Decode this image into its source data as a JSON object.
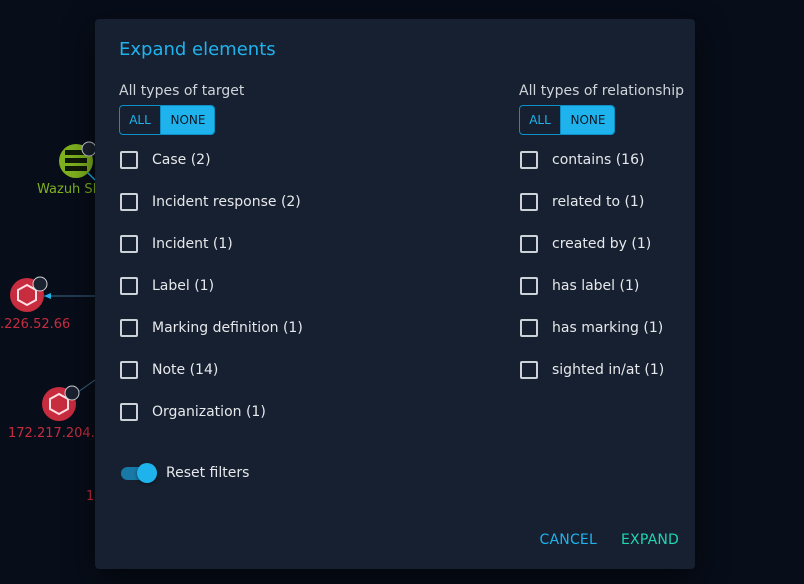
{
  "background": {
    "nodes": [
      {
        "label": "Wazuh SI",
        "icon": "server-icon",
        "color": "#7fb21f"
      },
      {
        "label": ".226.52.66",
        "icon": "hexagon-icon",
        "color": "#c72c3f"
      },
      {
        "label": "172.217.204.",
        "icon": "hexagon-icon",
        "color": "#c72c3f"
      },
      {
        "label": "1",
        "icon": "hexagon-icon",
        "color": "#c72c3f"
      }
    ]
  },
  "dialog": {
    "title": "Expand elements",
    "targets": {
      "title": "All types of target",
      "all_label": "ALL",
      "none_label": "NONE",
      "items": [
        {
          "label": "Case (2)",
          "checked": false
        },
        {
          "label": "Incident response (2)",
          "checked": false
        },
        {
          "label": "Incident (1)",
          "checked": false
        },
        {
          "label": "Label (1)",
          "checked": false
        },
        {
          "label": "Marking definition (1)",
          "checked": false
        },
        {
          "label": "Note (14)",
          "checked": false
        },
        {
          "label": "Organization (1)",
          "checked": false
        }
      ]
    },
    "relationships": {
      "title": "All types of relationship",
      "all_label": "ALL",
      "none_label": "NONE",
      "items": [
        {
          "label": "contains (16)",
          "checked": false
        },
        {
          "label": "related to (1)",
          "checked": false
        },
        {
          "label": "created by (1)",
          "checked": false
        },
        {
          "label": "has label (1)",
          "checked": false
        },
        {
          "label": "has marking (1)",
          "checked": false
        },
        {
          "label": "sighted in/at (1)",
          "checked": false
        }
      ]
    },
    "reset_filters": {
      "label": "Reset filters",
      "on": true
    },
    "cancel_label": "CANCEL",
    "expand_label": "EXPAND"
  },
  "colors": {
    "accent": "#1fb3ee",
    "expand": "#1fd6b3",
    "dialog_bg": "#172030",
    "page_bg": "#070d19"
  }
}
